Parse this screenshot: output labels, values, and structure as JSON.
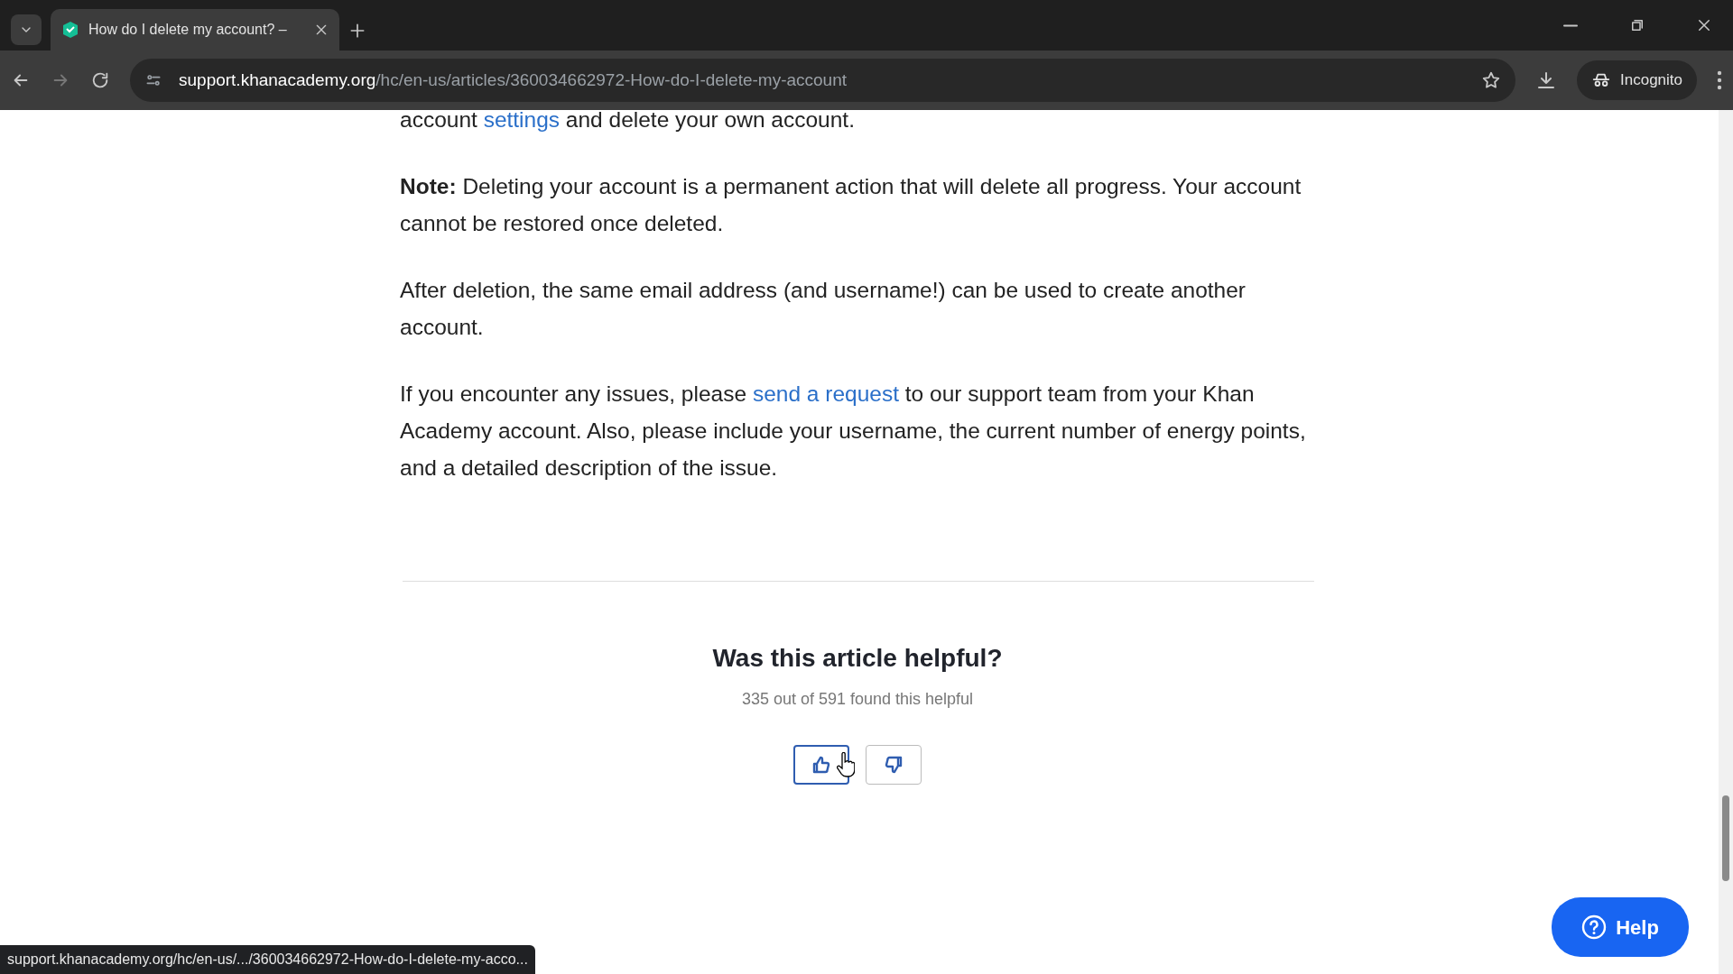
{
  "browser": {
    "tab": {
      "title": "How do I delete my account? –",
      "selected": true
    },
    "url": {
      "host": "support.khanacademy.org",
      "path": "/hc/en-us/articles/360034662972-How-do-I-delete-my-account"
    },
    "profile": "Incognito"
  },
  "article": {
    "paragraphs": [
      [
        {
          "text": "account "
        },
        {
          "text": "settings",
          "link": true
        },
        {
          "text": " and delete your own account."
        }
      ],
      [
        {
          "text": "**Note:** Deleting your account is a permanent action that will delete all progress. Your account cannot be restored once deleted."
        }
      ],
      [
        {
          "text": "After deletion, the same email address (and username!) can be used to create another account."
        }
      ],
      [
        {
          "text": "If you encounter any issues, please "
        },
        {
          "text": "send a request",
          "link": true
        },
        {
          "text": " to our support team from your Khan Academy account. Also, please include your username, the current number of energy points, and a detailed description of the issue."
        }
      ]
    ]
  },
  "feedback": {
    "title": "Was this article helpful?",
    "count": "335 out of 591 found this helpful",
    "votes": [
      {
        "kind": "up",
        "hovered": true
      },
      {
        "kind": "down",
        "hovered": false
      }
    ]
  },
  "status_url": "support.khanacademy.org/hc/en-us/.../360034662972-How-do-I-delete-my-acco...",
  "help_button": "Help"
}
